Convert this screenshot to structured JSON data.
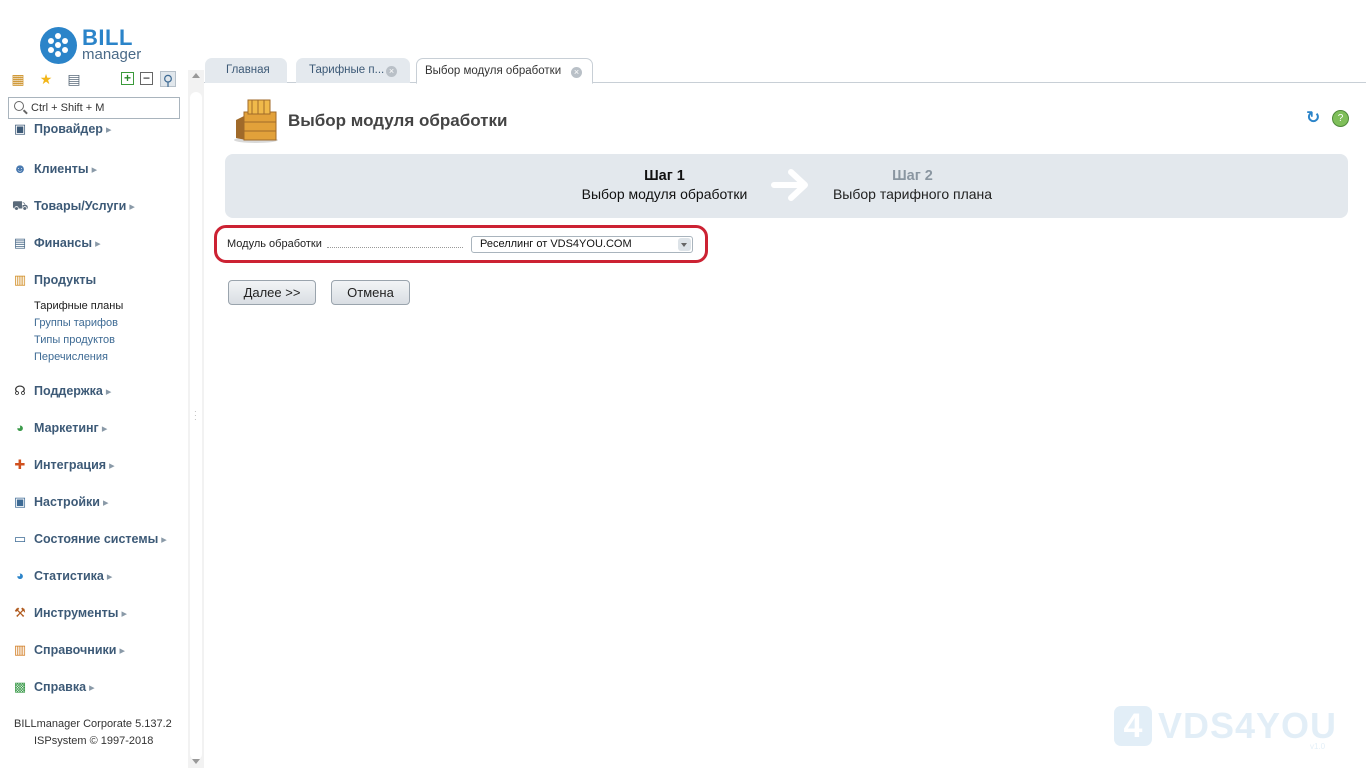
{
  "logo": {
    "title": "BILL",
    "subtitle": "manager"
  },
  "search": {
    "placeholder": "Ctrl + Shift + M"
  },
  "menu": {
    "partial_top": "Провайдер",
    "items": [
      {
        "label": "Клиенты",
        "icon": "user-icon"
      },
      {
        "label": "Товары/Услуги",
        "icon": "cart-icon"
      },
      {
        "label": "Финансы",
        "icon": "finance-icon"
      },
      {
        "label": "Продукты",
        "icon": "products-icon"
      },
      {
        "label": "Поддержка",
        "icon": "headset-icon"
      },
      {
        "label": "Маркетинг",
        "icon": "pie-chart-icon"
      },
      {
        "label": "Интеграция",
        "icon": "integration-icon"
      },
      {
        "label": "Настройки",
        "icon": "settings-icon"
      },
      {
        "label": "Состояние системы",
        "icon": "monitor-icon"
      },
      {
        "label": "Статистика",
        "icon": "statistics-icon"
      },
      {
        "label": "Инструменты",
        "icon": "tools-icon"
      },
      {
        "label": "Справочники",
        "icon": "reference-icon"
      },
      {
        "label": "Справка",
        "icon": "help-book-icon"
      }
    ],
    "products_sub": [
      "Тарифные планы",
      "Группы тарифов",
      "Типы продуктов",
      "Перечисления"
    ]
  },
  "version": {
    "line1": "BILLmanager Corporate 5.137.2",
    "line2": "ISPsystem © 1997-2018"
  },
  "tabs": [
    {
      "label": "Главная"
    },
    {
      "label": "Тарифные п..."
    },
    {
      "label": "Выбор модуля обработки"
    }
  ],
  "page": {
    "title": "Выбор модуля обработки",
    "steps": [
      {
        "number": "Шаг 1",
        "desc": "Выбор модуля обработки"
      },
      {
        "number": "Шаг 2",
        "desc": "Выбор тарифного плана"
      }
    ],
    "field": {
      "label": "Модуль обработки",
      "value": "Реселлинг от VDS4YOU.COM"
    },
    "buttons": {
      "next": "Далее >>",
      "cancel": "Отмена"
    }
  },
  "watermark": {
    "digit": "4",
    "text": "VDS4YOU",
    "small": "v1.0"
  },
  "colors": {
    "accent": "#2b84c9",
    "highlight": "#cc2233",
    "steps_bg": "#e3e8ed"
  }
}
